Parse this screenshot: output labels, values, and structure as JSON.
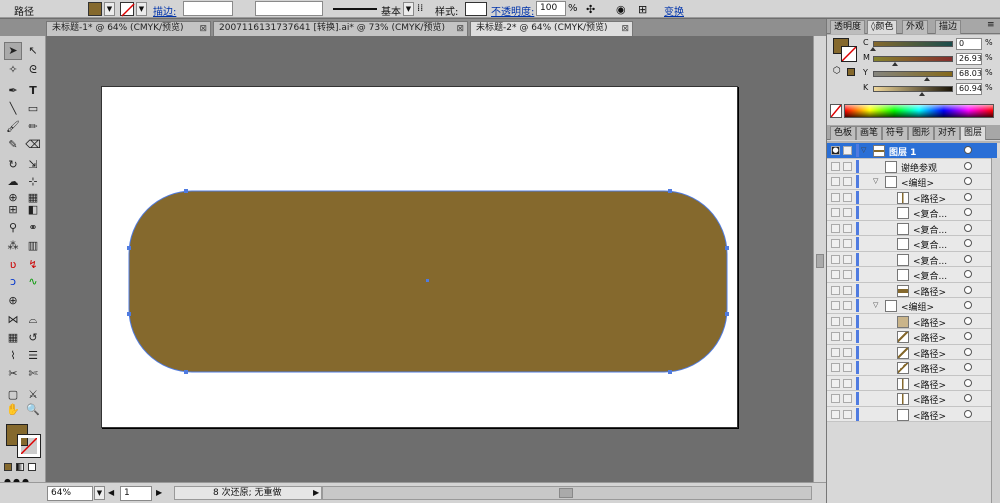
{
  "control_bar": {
    "object_label": "路径",
    "fill_color": "#85692d",
    "stroke_label": "描边:",
    "stroke_weight": "",
    "brush_value": "",
    "profile_label": "基本",
    "style_label": "样式:",
    "opacity_label": "不透明度:",
    "opacity_value": "100",
    "opacity_unit": "%",
    "transform_label": "变换"
  },
  "tabs": [
    {
      "label": "未标题-1* @ 64% (CMYK/预览)",
      "active": false
    },
    {
      "label": "2007116131737641 [转换].ai* @ 73% (CMYK/预览)",
      "active": false
    },
    {
      "label": "未标题-2* @ 64% (CMYK/预览)",
      "active": true
    }
  ],
  "artwork": {
    "shape": "rounded-rectangle",
    "fill_color": "#85692d",
    "selection_color": "#4f7be0"
  },
  "color_panel": {
    "tabs": [
      "透明度",
      "颜色",
      "外观",
      "描边"
    ],
    "active_tab": "颜色",
    "swatch_color": "#85692d",
    "channels": [
      {
        "label": "C",
        "value": "0",
        "unit": "%",
        "fraction": 0.0,
        "gradient": [
          "#85692d",
          "#1a4d4d"
        ]
      },
      {
        "label": "M",
        "value": "26.93",
        "unit": "%",
        "fraction": 0.27,
        "gradient": [
          "#85842d",
          "#852d2d"
        ]
      },
      {
        "label": "Y",
        "value": "68.03",
        "unit": "%",
        "fraction": 0.68,
        "gradient": [
          "#85857e",
          "#85691a"
        ]
      },
      {
        "label": "K",
        "value": "60.94",
        "unit": "%",
        "fraction": 0.61,
        "gradient": [
          "#f0d89c",
          "#1a1408"
        ]
      }
    ]
  },
  "layers_panel": {
    "tabs": [
      "色板",
      "画笔",
      "符号",
      "图形",
      "对齐",
      "图层"
    ],
    "active_tab": "图层",
    "rows": [
      {
        "name": "图层 1",
        "indent": 0,
        "tri": "▽",
        "thumb": "layer",
        "top": true
      },
      {
        "name": "谢绝参观",
        "indent": 1,
        "tri": "",
        "thumb": "blank"
      },
      {
        "name": "<编组>",
        "indent": 1,
        "tri": "▽",
        "thumb": "blank"
      },
      {
        "name": "<路径>",
        "indent": 2,
        "tri": "",
        "thumb": "lines"
      },
      {
        "name": "<复合...",
        "indent": 2,
        "tri": "",
        "thumb": "blank"
      },
      {
        "name": "<复合...",
        "indent": 2,
        "tri": "",
        "thumb": "blank"
      },
      {
        "name": "<复合...",
        "indent": 2,
        "tri": "",
        "thumb": "blank"
      },
      {
        "name": "<复合...",
        "indent": 2,
        "tri": "",
        "thumb": "blank"
      },
      {
        "name": "<复合...",
        "indent": 2,
        "tri": "",
        "thumb": "blank"
      },
      {
        "name": "<路径>",
        "indent": 2,
        "tri": "",
        "thumb": "stripe"
      },
      {
        "name": "<编组>",
        "indent": 1,
        "tri": "▽",
        "thumb": "blank"
      },
      {
        "name": "<路径>",
        "indent": 2,
        "tri": "",
        "thumb": "tan"
      },
      {
        "name": "<路径>",
        "indent": 2,
        "tri": "",
        "thumb": "diag"
      },
      {
        "name": "<路径>",
        "indent": 2,
        "tri": "",
        "thumb": "diag"
      },
      {
        "name": "<路径>",
        "indent": 2,
        "tri": "",
        "thumb": "diag"
      },
      {
        "name": "<路径>",
        "indent": 2,
        "tri": "",
        "thumb": "lines"
      },
      {
        "name": "<路径>",
        "indent": 2,
        "tri": "",
        "thumb": "lines"
      },
      {
        "name": "<路径>",
        "indent": 2,
        "tri": "",
        "thumb": "blank"
      }
    ]
  },
  "status_bar": {
    "zoom": "64%",
    "artboard_number": "1",
    "status_text": "8 次还原; 无重做"
  },
  "tools_fill_color": "#85692d"
}
